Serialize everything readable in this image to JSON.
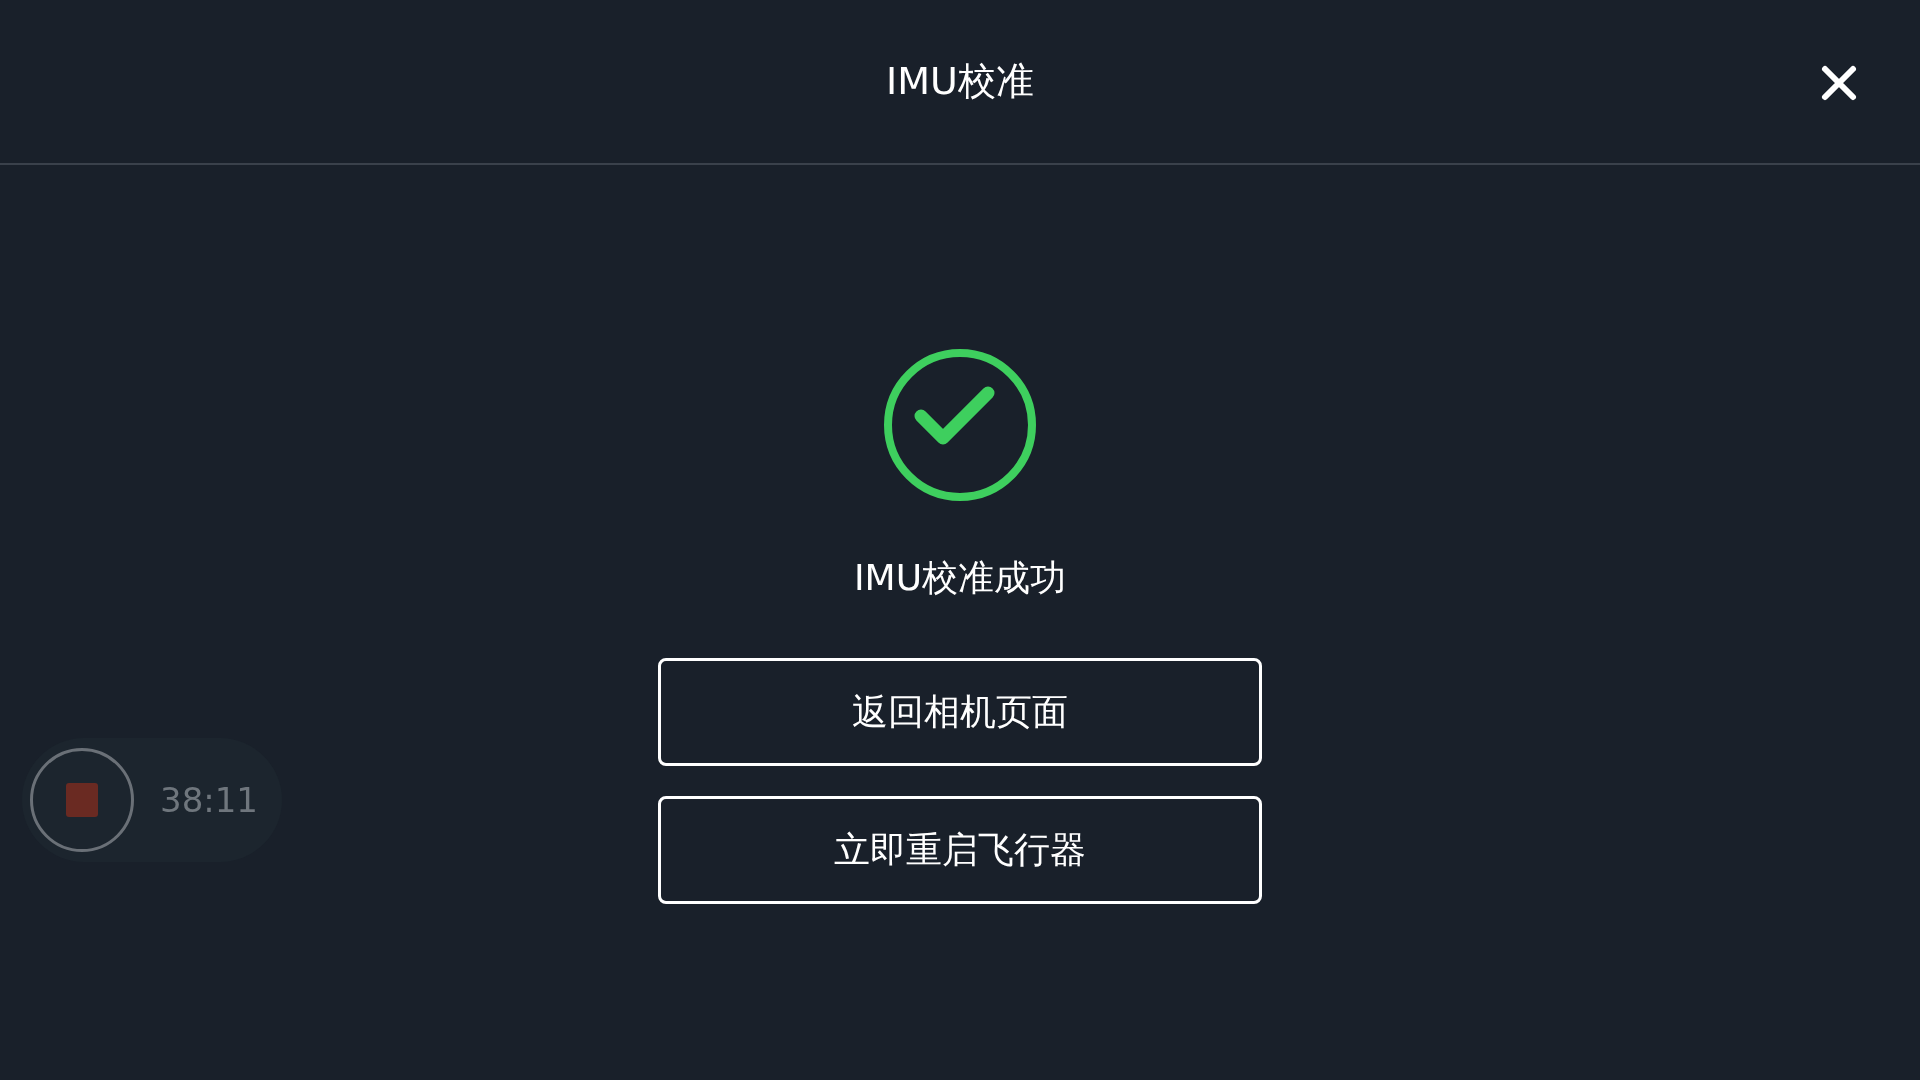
{
  "header": {
    "title": "IMU校准"
  },
  "result": {
    "succeeded": true,
    "message": "IMU校准成功"
  },
  "buttons": [
    "返回相机页面",
    "立即重启飞行器"
  ],
  "recording": {
    "time": "38:11"
  }
}
